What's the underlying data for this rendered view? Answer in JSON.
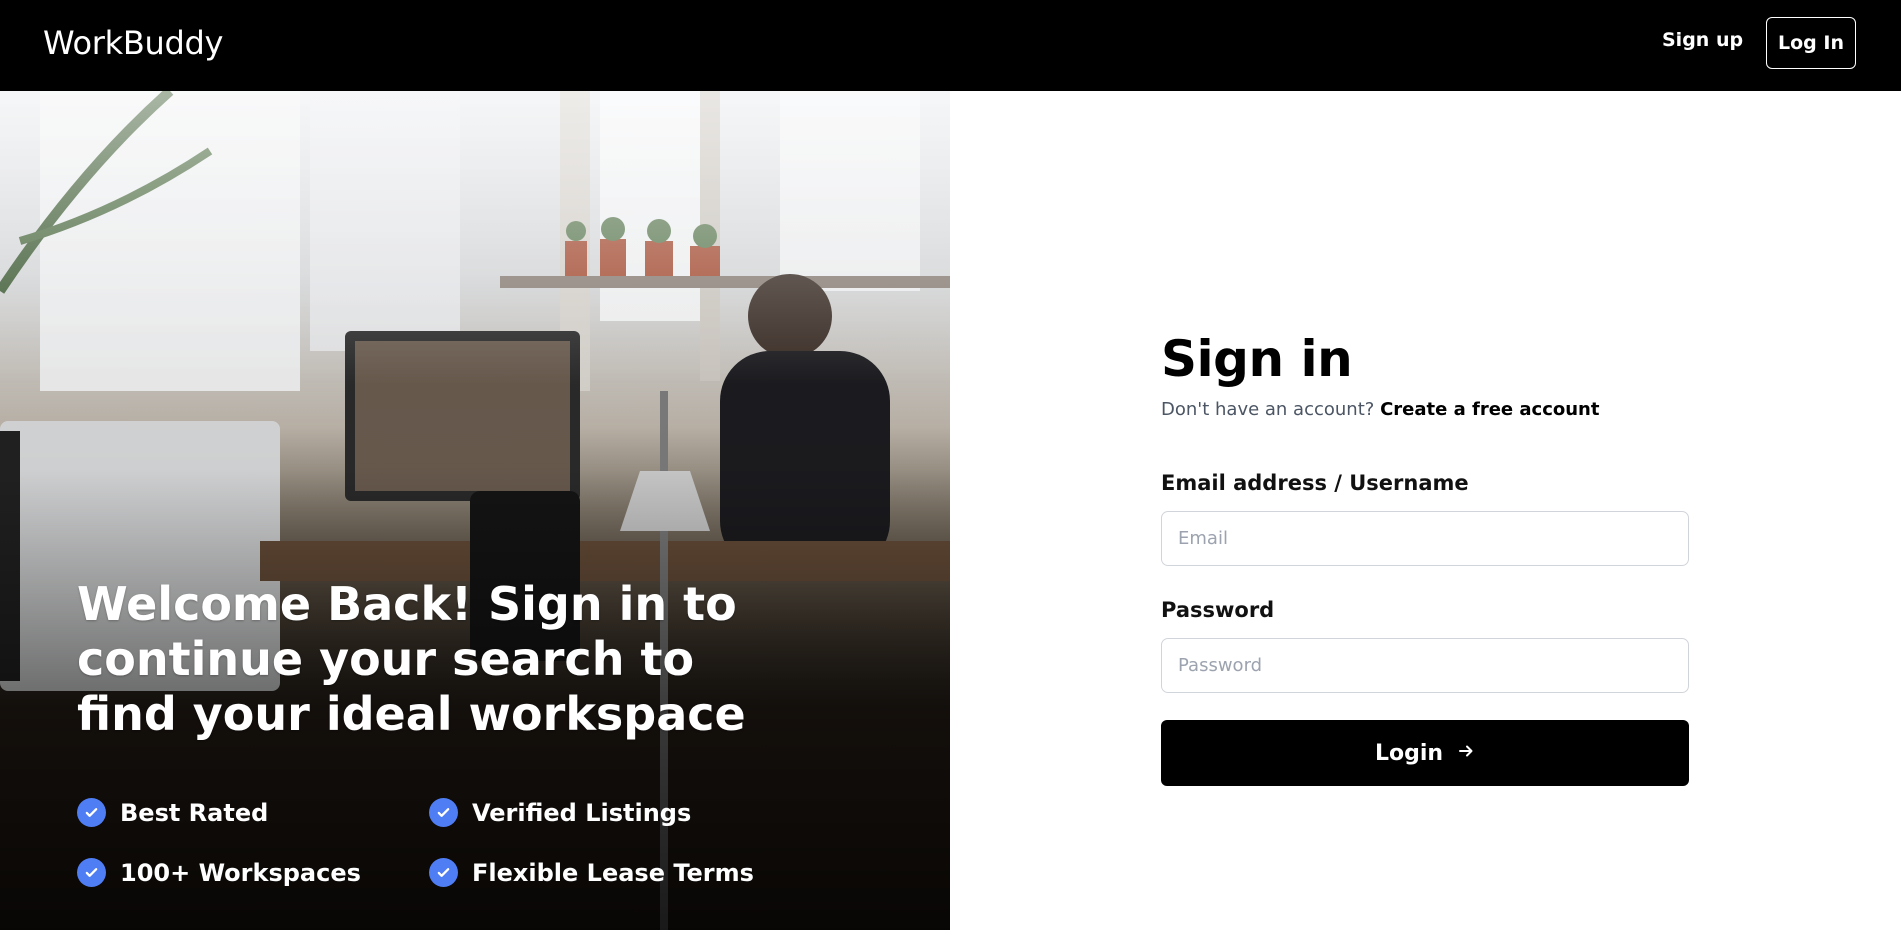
{
  "header": {
    "brand": "WorkBuddy",
    "signup_label": "Sign up",
    "login_label": "Log In"
  },
  "hero": {
    "heading": "Welcome Back! Sign in to continue your search to find your ideal workspace",
    "features": [
      "Best Rated",
      "Verified Listings",
      "100+ Workspaces",
      "Flexible Lease Terms"
    ]
  },
  "signin": {
    "title": "Sign in",
    "subtitle_prefix": "Don't have an account?",
    "subtitle_link": "Create a free account",
    "email_label": "Email address / Username",
    "email_placeholder": "Email",
    "email_value": "",
    "password_label": "Password",
    "password_placeholder": "Password",
    "password_value": "",
    "submit_label": "Login",
    "submit_icon": "arrow-right-icon"
  },
  "colors": {
    "header_bg": "#000000",
    "accent_check": "#4f7df3",
    "button_bg": "#000000"
  }
}
